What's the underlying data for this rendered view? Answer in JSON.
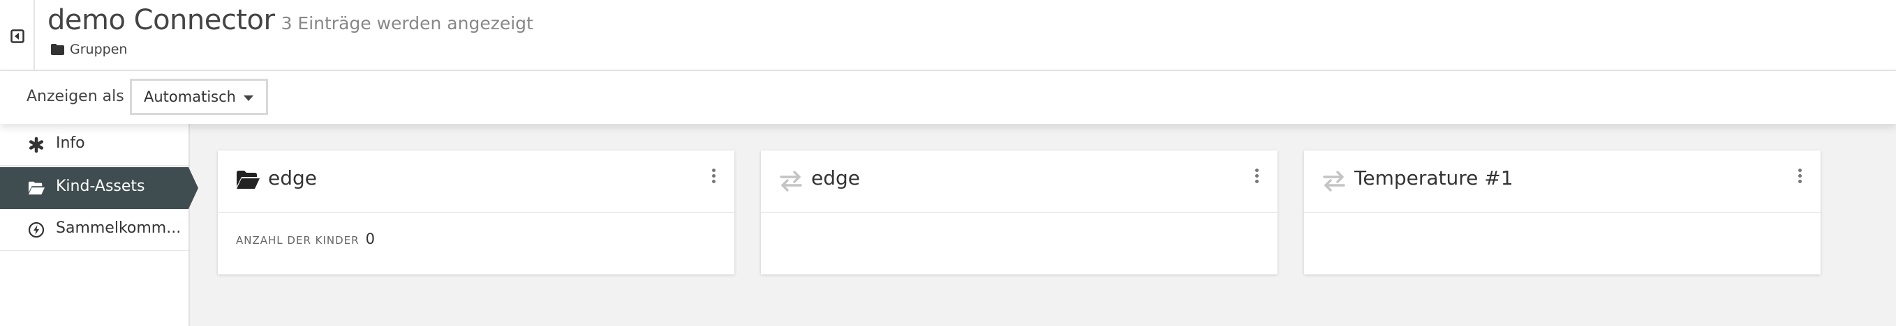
{
  "header": {
    "title": "demo Connector",
    "subtitle": "3 Einträge werden angezeigt",
    "breadcrumb": "Gruppen"
  },
  "toolbar": {
    "display_label": "Anzeigen als",
    "display_value": "Automatisch"
  },
  "sidebar": {
    "items": [
      {
        "label": "Info",
        "icon": "asterisk-icon",
        "active": false
      },
      {
        "label": "Kind-Assets",
        "icon": "folder-open-icon",
        "active": true
      },
      {
        "label": "Sammelkomm...",
        "icon": "bolt-circle-icon",
        "active": false
      }
    ]
  },
  "cards": [
    {
      "title": "edge",
      "icon": "folder-open-icon",
      "meta_label": "ANZAHL DER KINDER",
      "meta_value": "0"
    },
    {
      "title": "edge",
      "icon": "transfer-arrows-icon"
    },
    {
      "title": "Temperature #1",
      "icon": "transfer-arrows-icon"
    }
  ],
  "colors": {
    "active_sidebar_bg": "#3f4c50",
    "page_bg": "#f2f2f2"
  }
}
